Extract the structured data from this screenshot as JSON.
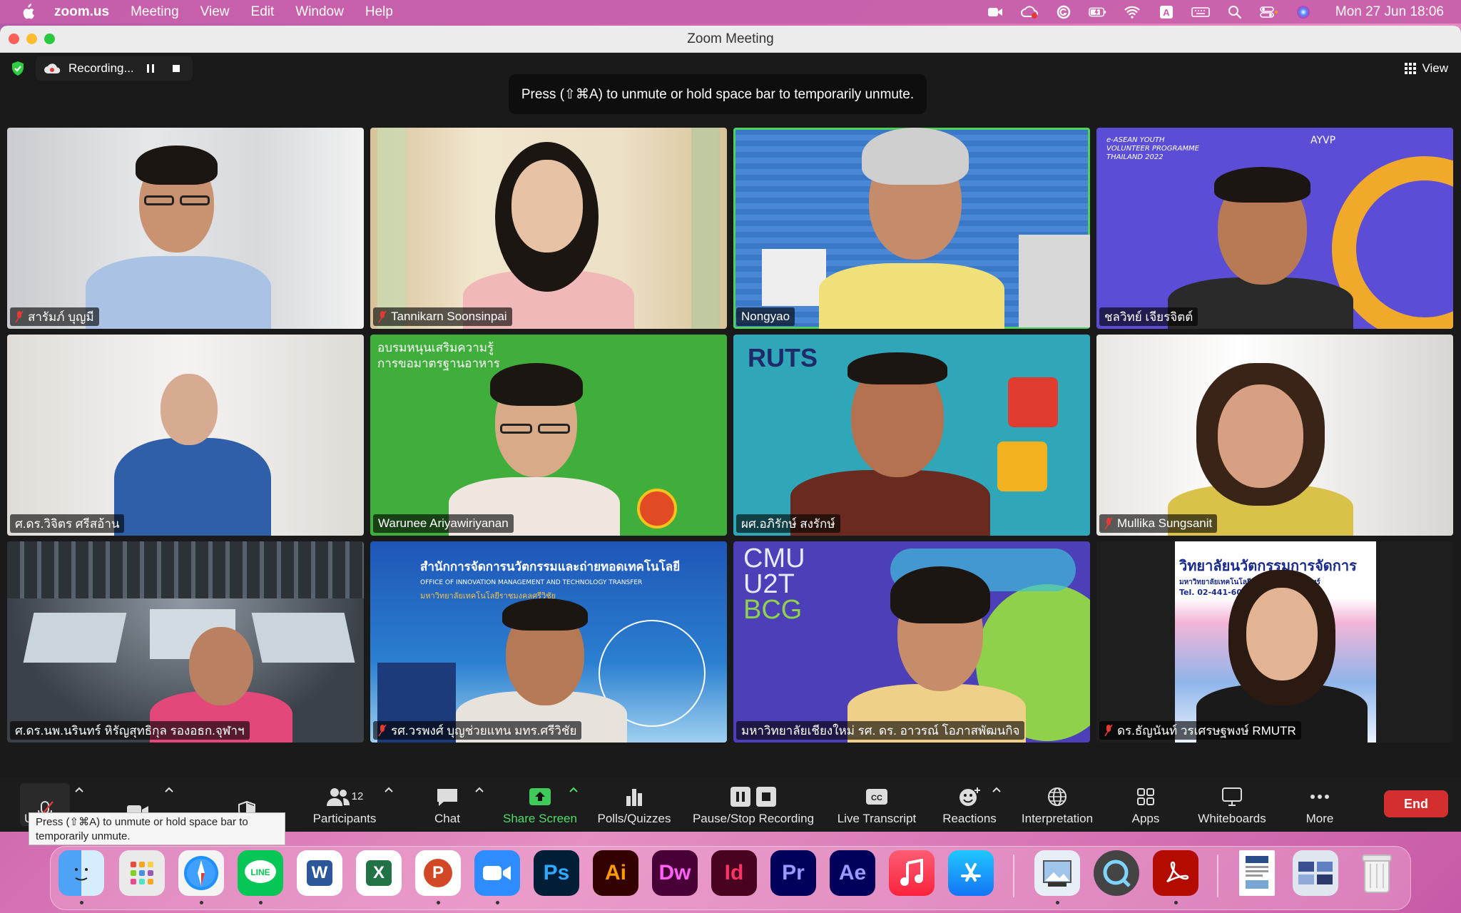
{
  "menubar": {
    "app_name": "zoom.us",
    "menus": [
      "Meeting",
      "View",
      "Edit",
      "Window",
      "Help"
    ],
    "clock": "Mon 27 Jun  18:06"
  },
  "window": {
    "title": "Zoom Meeting"
  },
  "topbar": {
    "recording_label": "Recording...",
    "view_label": "View"
  },
  "toast": "Press  (⇧⌘A) to unmute or hold space bar to temporarily unmute.",
  "participants": [
    {
      "name": "สารัมภ์ บุญมี",
      "muted": true
    },
    {
      "name": "Tannikarn Soonsinpai",
      "muted": true
    },
    {
      "name": "Nongyao",
      "muted": false,
      "active_speaker": true
    },
    {
      "name": "ชลวิทย์ เจียรจิตต์",
      "muted": false
    },
    {
      "name": "ศ.ดร.วิจิตร ศรีสอ้าน",
      "muted": false
    },
    {
      "name": "Warunee Ariyawiriyanan",
      "muted": false
    },
    {
      "name": "ผศ.อภิรักษ์ สงรักษ์",
      "muted": false
    },
    {
      "name": "Mullika Sungsanit",
      "muted": true
    },
    {
      "name": "ศ.ดร.นพ.นรินทร์ หิรัญสุทธิกุล รองอธก.จุฬาฯ",
      "muted": false
    },
    {
      "name": "รศ.วรพงศ์ บุญช่วยแทน มทร.ศรีวิชัย",
      "muted": true
    },
    {
      "name": "มหาวิทยาลัยเชียงใหม่ รศ. ดร. อาวรณ์ โอภาสพัฒนกิจ",
      "muted": false
    },
    {
      "name": "ดร.ธัญนันท์ วรเศรษฐพงษ์ RMUTR",
      "muted": true
    }
  ],
  "backgrounds": {
    "ayvp_title_1": "e-ASEAN YOUTH",
    "ayvp_title_2": "VOLUNTEER PROGRAMME",
    "ayvp_title_3": "THAILAND 2022",
    "ayvp_logo": "AYVP",
    "green_banner_1": "อบรมหนุนเสริมความรู้",
    "green_banner_2": "การขอมาตรฐานอาหาร",
    "ruts_logo": "RUTS",
    "oimtt_title_th": "สำนักการจัดการนวัตกรรมและถ่ายทอดเทคโนโลยี",
    "oimtt_title_en": "OFFICE OF INNOVATION MANAGEMENT AND TECHNOLOGY TRANSFER",
    "oimtt_sub": "มหาวิทยาลัยเทคโนโลยีราชมงคลศรีวิชัย",
    "cmu_1": "CMU",
    "cmu_2": "U2T",
    "cmu_3": "BCG",
    "rmutr_title": "วิทยาลัยนวัตกรรมการจัดการ",
    "rmutr_sub": "มหาวิทยาลัยเทคโนโลยีราชมงคลรัตนโกสินทร์",
    "rmutr_tel": "Tel. 02-441-6000"
  },
  "toolbar": {
    "participants_count": "12",
    "participants_label": "Participants",
    "chat_label": "Chat",
    "share_label": "Share Screen",
    "polls_label": "Polls/Quizzes",
    "recording_label": "Pause/Stop Recording",
    "transcript_label": "Live Transcript",
    "reactions_label": "Reactions",
    "interpretation_label": "Interpretation",
    "apps_label": "Apps",
    "whiteboards_label": "Whiteboards",
    "more_label": "More",
    "end_label": "End",
    "unmute_label": "U"
  },
  "tooltip": "Press  (⇧⌘A) to unmute or hold space bar to temporarily unmute.",
  "dock": {
    "ps": "Ps",
    "ai": "Ai",
    "dw": "Dw",
    "id": "Id",
    "pr": "Pr",
    "ae": "Ae",
    "word": "W",
    "excel": "X",
    "ppt": "P"
  },
  "colors": {
    "accent_green": "#4fd15a",
    "end_red": "#d32f2f",
    "share_green": "#4ddd6a"
  }
}
